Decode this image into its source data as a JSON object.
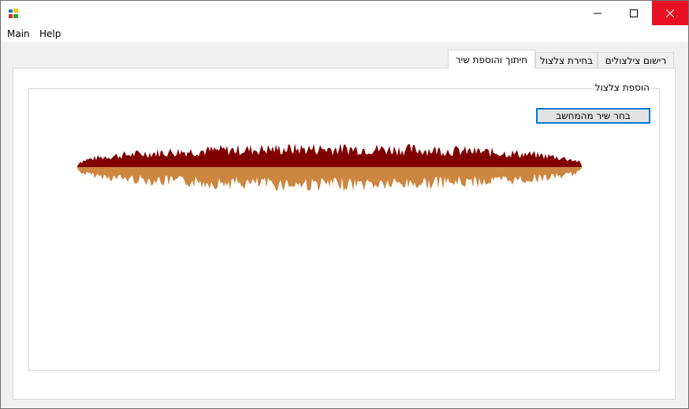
{
  "window": {
    "close_color": "#e81123"
  },
  "menu": {
    "items": [
      {
        "label": "Main"
      },
      {
        "label": "Help"
      }
    ]
  },
  "tabs": [
    {
      "label": "רישום צילצולים",
      "active": false
    },
    {
      "label": "בחירת צלצול",
      "active": false
    },
    {
      "label": "חיתוך והוספת שיר",
      "active": true
    }
  ],
  "group": {
    "title": "הוספת צלצול",
    "button_label": "בחר שיר מהמחשב"
  },
  "waveform": {
    "top_color": "#800000",
    "bottom_color": "#cd853f"
  }
}
